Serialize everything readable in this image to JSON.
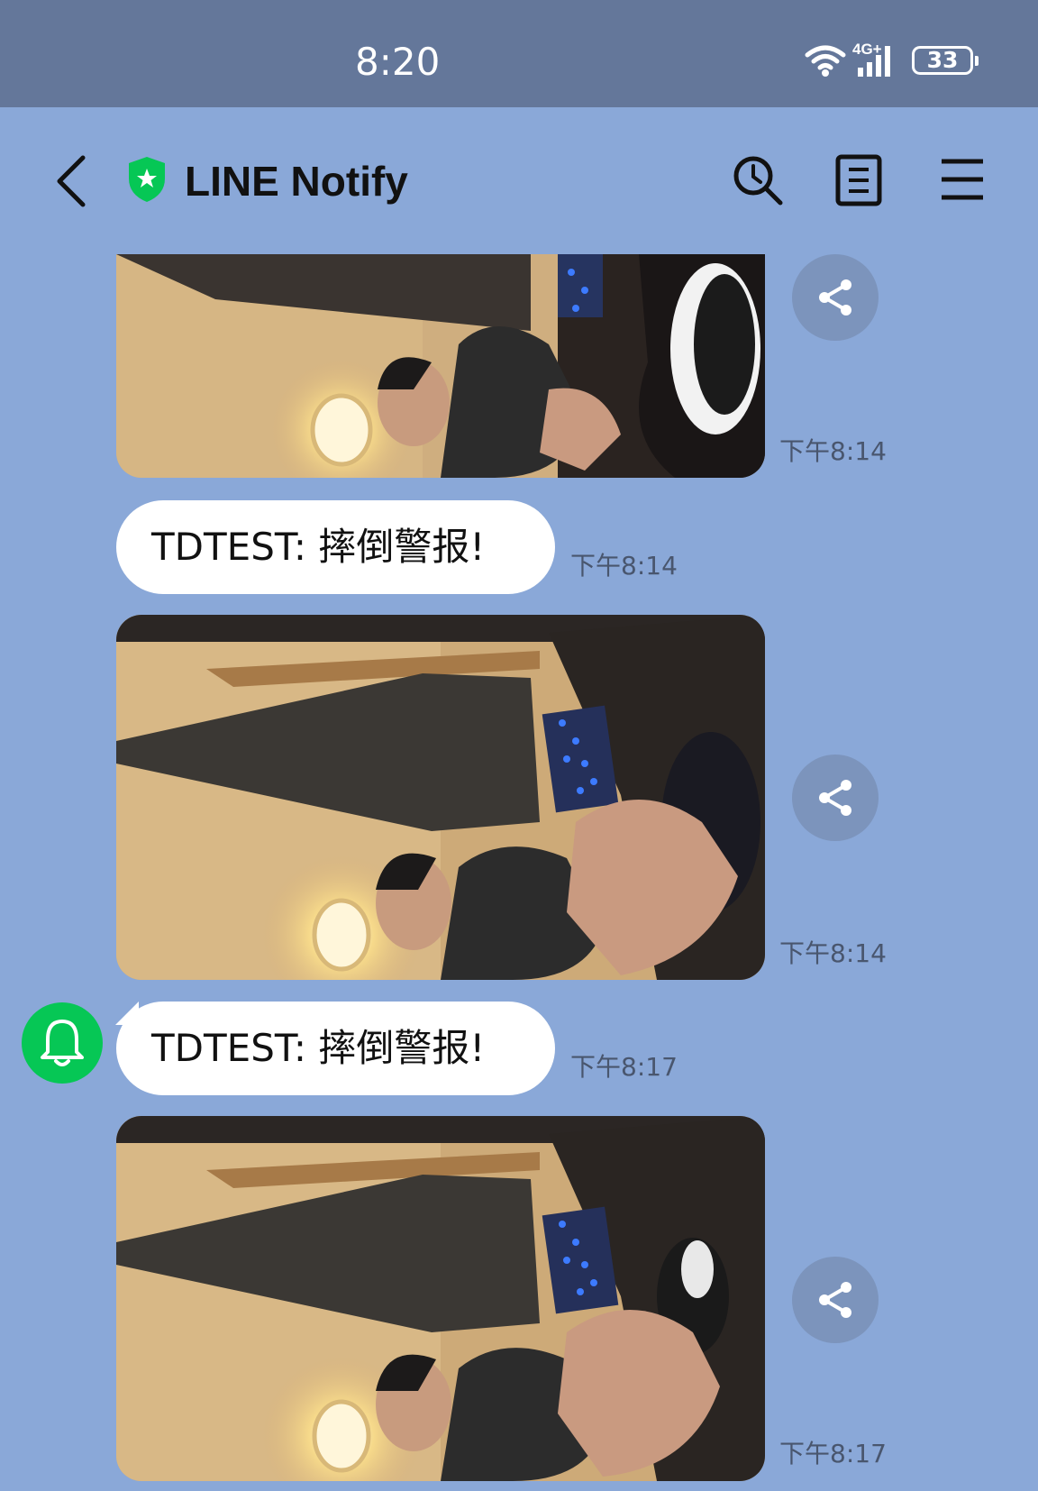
{
  "status_bar": {
    "time": "8:20",
    "network": "4G+",
    "battery": "33",
    "background": "#64779a"
  },
  "header": {
    "back_icon": "chevron-left-icon",
    "title": "LINE Notify",
    "shield_color": "#06c755",
    "actions": [
      "search-history-icon",
      "notes-icon",
      "menu-icon"
    ]
  },
  "messages": [
    {
      "type": "image",
      "time": "下午8:14",
      "description_icon": "camera-snapshot"
    },
    {
      "type": "text",
      "text": "TDTEST: 摔倒警报!",
      "time": "下午8:14"
    },
    {
      "type": "image",
      "time": "下午8:14",
      "description_icon": "camera-snapshot"
    },
    {
      "type": "text",
      "text": "TDTEST: 摔倒警报!",
      "time": "下午8:17",
      "avatar_icon": "bell-icon"
    },
    {
      "type": "image",
      "time": "下午8:17",
      "description_icon": "camera-snapshot"
    }
  ],
  "colors": {
    "chat_background": "#8aa8d8",
    "bubble": "#ffffff",
    "share_button": "#7c94bc",
    "avatar": "#06c755"
  }
}
